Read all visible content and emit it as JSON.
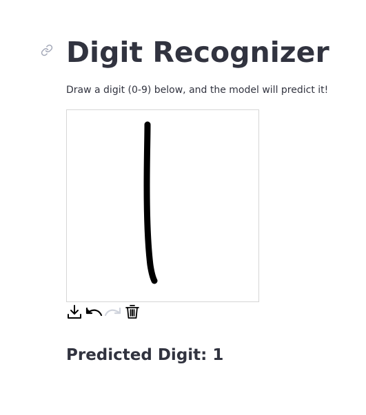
{
  "header": {
    "title": "Digit Recognizer",
    "anchor_icon": "link-icon"
  },
  "instructions": "Draw a digit (0-9) below, and the model will predict it!",
  "canvas": {
    "background": "#ffffff",
    "stroke_color": "#000000"
  },
  "toolbar": {
    "tools": [
      {
        "icon": "download-icon",
        "enabled": true
      },
      {
        "icon": "undo-icon",
        "enabled": true
      },
      {
        "icon": "redo-icon",
        "enabled": false
      },
      {
        "icon": "trash-icon",
        "enabled": true
      }
    ]
  },
  "result": {
    "text": "Predicted Digit: 1"
  },
  "colors": {
    "text": "#31333f",
    "muted_icon": "#a3a8b8",
    "disabled_icon": "#cfd3dc"
  }
}
